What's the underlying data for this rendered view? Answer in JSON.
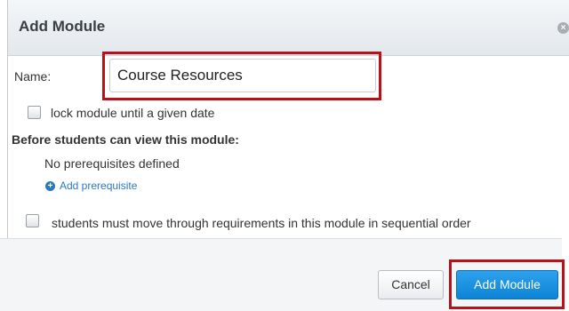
{
  "dialog": {
    "title": "Add Module",
    "close_icon": "close-icon"
  },
  "form": {
    "name_label": "Name:",
    "name_value": "Course Resources",
    "lock_label": "lock module until a given date",
    "lock_checked": false,
    "prereq_heading": "Before students can view this module:",
    "no_prereq_text": "No prerequisites defined",
    "add_prereq_label": "Add prerequisite",
    "add_prereq_icon": "plus-circle-icon",
    "sequential_label": "students must move through requirements in this module in sequential order",
    "sequential_checked": false
  },
  "footer": {
    "cancel_label": "Cancel",
    "add_label": "Add Module"
  },
  "colors": {
    "primary_button": "#0c84d6",
    "link": "#2a78c4",
    "highlight": "#b5121b"
  }
}
